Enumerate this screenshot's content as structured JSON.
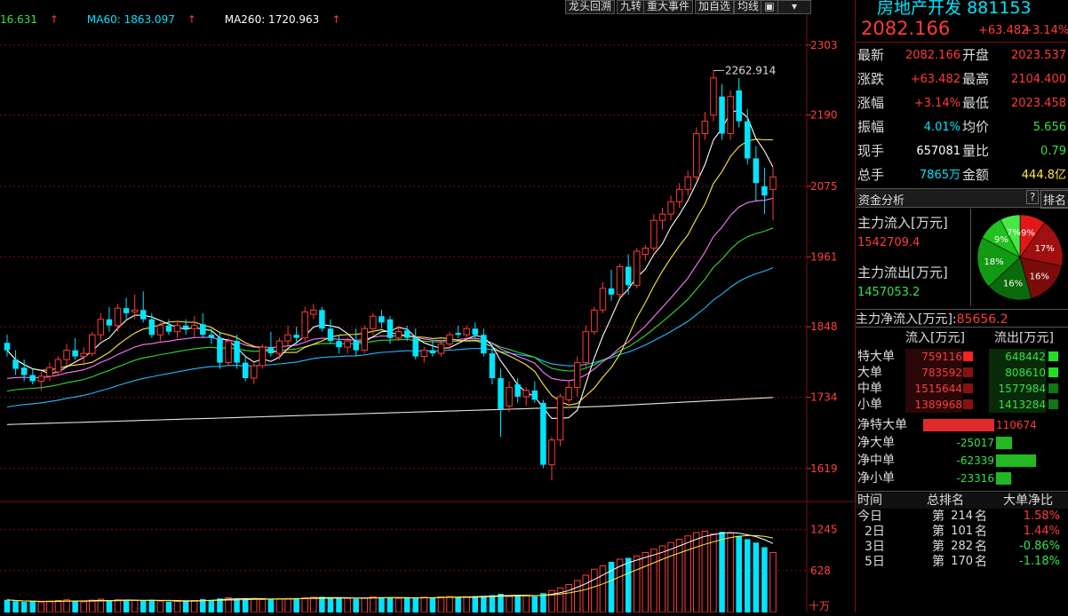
{
  "toolbar": {
    "buttons": [
      "龙头回溯",
      "九转",
      "重大事件",
      "加自选",
      "均线"
    ],
    "icons": [
      "restore-icon",
      "dropdown-icon"
    ]
  },
  "indicators": {
    "ma_partial": "16.631",
    "ma60": "MA60: 1863.097",
    "ma260": "MA260: 1720.963",
    "arrow": "↑"
  },
  "colors": {
    "up": "#ff3b3b",
    "down": "#00e5ff",
    "ma5": "#ffffff",
    "ma10": "#ffeb3b",
    "ma20": "#ff79ff",
    "ma30": "#33dd33",
    "ma60": "#22bbff",
    "ma260": "#e8e8d8",
    "grid": "#7a1010"
  },
  "price_axis": {
    "ticks": [
      "2303",
      "2190",
      "2075",
      "1961",
      "1848",
      "1734",
      "1619"
    ],
    "high_label": "2262.914"
  },
  "volume_axis": {
    "ticks": [
      "1245",
      "628"
    ],
    "unit": "十万"
  },
  "stock": {
    "name": "房地产开发",
    "code": "881153",
    "price": "2082.166",
    "change": "+63.482",
    "change_pct": "+3.14%"
  },
  "quote": [
    {
      "l1": "最新",
      "v1": "2082.166",
      "c1": "red",
      "l2": "开盘",
      "v2": "2023.537",
      "c2": "red"
    },
    {
      "l1": "涨跌",
      "v1": "+63.482",
      "c1": "red",
      "l2": "最高",
      "v2": "2104.400",
      "c2": "red"
    },
    {
      "l1": "涨幅",
      "v1": "+3.14%",
      "c1": "red",
      "l2": "最低",
      "v2": "2023.458",
      "c2": "red"
    },
    {
      "l1": "振幅",
      "v1": "4.01%",
      "c1": "cyan",
      "l2": "均价",
      "v2": "5.656",
      "c2": "green"
    },
    {
      "l1": "现手",
      "v1": "657081",
      "c1": "white",
      "l2": "量比",
      "v2": "0.79",
      "c2": "green"
    },
    {
      "l1": "总手",
      "v1": "7865万",
      "c1": "cyan",
      "l2": "金额",
      "v2": "444.8亿",
      "c2": "yellow"
    }
  ],
  "funds": {
    "header": "资金分析",
    "help": "?",
    "rank_btn": "排名",
    "inflow_label": "主力流入[万元]",
    "inflow_value": "1542709.4",
    "outflow_label": "主力流出[万元]",
    "outflow_value": "1457053.2",
    "net_label": "主力净流入[万元]:",
    "net_value": "85656.2",
    "pie": [
      {
        "pct": 9,
        "label": "9%",
        "color": "#e01818"
      },
      {
        "pct": 17,
        "label": "17%",
        "color": "#a01010"
      },
      {
        "pct": 16,
        "label": "16%",
        "color": "#7a0c0c"
      },
      {
        "pct": 16,
        "label": "16%",
        "color": "#0c6a0c"
      },
      {
        "pct": 18,
        "label": "18%",
        "color": "#139a13"
      },
      {
        "pct": 9,
        "label": "9%",
        "color": "#1fc21f"
      },
      {
        "pct": 7,
        "label": "7%",
        "color": "#45e845"
      }
    ]
  },
  "flow": {
    "col_in": "流入[万元]",
    "col_out": "流出[万元]",
    "rows": [
      {
        "name": "特大单",
        "in": "759116",
        "out": "648442"
      },
      {
        "name": "大单",
        "in": "783592",
        "out": "808610"
      },
      {
        "name": "中单",
        "in": "1515644",
        "out": "1577984"
      },
      {
        "name": "小单",
        "in": "1389968",
        "out": "1413284"
      }
    ],
    "net": [
      {
        "name": "净特大单",
        "value": "110674",
        "amount": 110674
      },
      {
        "name": "净大单",
        "value": "-25017",
        "amount": -25017
      },
      {
        "name": "净中单",
        "value": "-62339",
        "amount": -62339
      },
      {
        "name": "净小单",
        "value": "-23316",
        "amount": -23316
      }
    ]
  },
  "ranking": {
    "headers": [
      "时间",
      "总排名",
      "大单净比"
    ],
    "prefix": "第",
    "suffix": "名",
    "rows": [
      {
        "day": "今日",
        "rank": "214",
        "ratio": "1.58%",
        "up": true
      },
      {
        "day": "2日",
        "rank": "101",
        "ratio": "1.44%",
        "up": true
      },
      {
        "day": "3日",
        "rank": "282",
        "ratio": "-0.86%",
        "up": false
      },
      {
        "day": "5日",
        "rank": "170",
        "ratio": "-1.18%",
        "up": false
      }
    ]
  },
  "chart_data": {
    "type": "candlestick",
    "y_range": [
      1580,
      2330
    ],
    "volume_range": [
      0,
      1400
    ],
    "candles": [
      [
        1822,
        1835,
        1800,
        1810
      ],
      [
        1795,
        1810,
        1770,
        1780
      ],
      [
        1782,
        1795,
        1760,
        1770
      ],
      [
        1770,
        1780,
        1755,
        1760
      ],
      [
        1760,
        1775,
        1745,
        1768
      ],
      [
        1768,
        1790,
        1760,
        1782
      ],
      [
        1775,
        1800,
        1770,
        1795
      ],
      [
        1795,
        1820,
        1785,
        1810
      ],
      [
        1810,
        1830,
        1795,
        1800
      ],
      [
        1800,
        1815,
        1785,
        1805
      ],
      [
        1805,
        1840,
        1800,
        1835
      ],
      [
        1835,
        1870,
        1825,
        1860
      ],
      [
        1860,
        1880,
        1840,
        1850
      ],
      [
        1850,
        1885,
        1840,
        1878
      ],
      [
        1878,
        1895,
        1860,
        1870
      ],
      [
        1872,
        1900,
        1860,
        1875
      ],
      [
        1875,
        1905,
        1855,
        1860
      ],
      [
        1860,
        1870,
        1830,
        1835
      ],
      [
        1835,
        1855,
        1825,
        1850
      ],
      [
        1850,
        1860,
        1835,
        1840
      ],
      [
        1840,
        1858,
        1830,
        1850
      ],
      [
        1850,
        1860,
        1835,
        1845
      ],
      [
        1845,
        1865,
        1830,
        1850
      ],
      [
        1852,
        1870,
        1830,
        1835
      ],
      [
        1835,
        1845,
        1820,
        1830
      ],
      [
        1830,
        1840,
        1780,
        1790
      ],
      [
        1790,
        1830,
        1785,
        1825
      ],
      [
        1825,
        1835,
        1780,
        1790
      ],
      [
        1790,
        1800,
        1760,
        1765
      ],
      [
        1765,
        1790,
        1755,
        1785
      ],
      [
        1785,
        1820,
        1780,
        1815
      ],
      [
        1815,
        1840,
        1800,
        1805
      ],
      [
        1805,
        1830,
        1795,
        1825
      ],
      [
        1825,
        1850,
        1815,
        1835
      ],
      [
        1835,
        1848,
        1820,
        1830
      ],
      [
        1830,
        1880,
        1825,
        1872
      ],
      [
        1868,
        1885,
        1860,
        1875
      ],
      [
        1875,
        1880,
        1840,
        1845
      ],
      [
        1845,
        1860,
        1820,
        1825
      ],
      [
        1825,
        1835,
        1805,
        1815
      ],
      [
        1815,
        1830,
        1805,
        1825
      ],
      [
        1825,
        1845,
        1800,
        1810
      ],
      [
        1810,
        1850,
        1805,
        1845
      ],
      [
        1845,
        1870,
        1835,
        1865
      ],
      [
        1865,
        1875,
        1845,
        1855
      ],
      [
        1860,
        1865,
        1820,
        1830
      ],
      [
        1830,
        1850,
        1825,
        1840
      ],
      [
        1842,
        1850,
        1825,
        1830
      ],
      [
        1830,
        1845,
        1795,
        1800
      ],
      [
        1800,
        1815,
        1790,
        1810
      ],
      [
        1810,
        1825,
        1800,
        1805
      ],
      [
        1805,
        1825,
        1800,
        1820
      ],
      [
        1820,
        1840,
        1810,
        1835
      ],
      [
        1838,
        1850,
        1830,
        1835
      ],
      [
        1835,
        1850,
        1825,
        1845
      ],
      [
        1845,
        1855,
        1830,
        1835
      ],
      [
        1835,
        1845,
        1800,
        1805
      ],
      [
        1805,
        1820,
        1755,
        1765
      ],
      [
        1765,
        1780,
        1670,
        1715
      ],
      [
        1720,
        1760,
        1710,
        1750
      ],
      [
        1755,
        1765,
        1725,
        1735
      ],
      [
        1735,
        1750,
        1720,
        1745
      ],
      [
        1745,
        1760,
        1725,
        1730
      ],
      [
        1725,
        1730,
        1620,
        1625
      ],
      [
        1625,
        1670,
        1600,
        1665
      ],
      [
        1665,
        1740,
        1655,
        1735
      ],
      [
        1730,
        1760,
        1725,
        1750
      ],
      [
        1750,
        1800,
        1735,
        1790
      ],
      [
        1790,
        1850,
        1780,
        1840
      ],
      [
        1840,
        1880,
        1835,
        1875
      ],
      [
        1875,
        1920,
        1870,
        1910
      ],
      [
        1910,
        1940,
        1890,
        1900
      ],
      [
        1900,
        1950,
        1895,
        1945
      ],
      [
        1945,
        1965,
        1900,
        1915
      ],
      [
        1915,
        1975,
        1910,
        1970
      ],
      [
        1965,
        1980,
        1955,
        1975
      ],
      [
        1975,
        2030,
        1970,
        2020
      ],
      [
        2020,
        2040,
        2005,
        2030
      ],
      [
        2030,
        2060,
        2020,
        2050
      ],
      [
        2050,
        2080,
        2040,
        2070
      ],
      [
        2070,
        2100,
        2060,
        2090
      ],
      [
        2090,
        2170,
        2085,
        2160
      ],
      [
        2160,
        2195,
        2150,
        2180
      ],
      [
        2190,
        2262,
        2180,
        2250
      ],
      [
        2220,
        2240,
        2150,
        2160
      ],
      [
        2160,
        2230,
        2150,
        2220
      ],
      [
        2230,
        2250,
        2170,
        2180
      ],
      [
        2180,
        2200,
        2110,
        2120
      ],
      [
        2120,
        2140,
        2050,
        2080
      ],
      [
        2075,
        2105,
        2030,
        2060
      ],
      [
        2070,
        2105,
        2020,
        2090
      ]
    ],
    "volume": [
      190,
      170,
      160,
      165,
      150,
      170,
      180,
      190,
      170,
      160,
      185,
      200,
      180,
      190,
      175,
      180,
      185,
      190,
      170,
      160,
      165,
      175,
      180,
      200,
      190,
      210,
      220,
      205,
      210,
      200,
      195,
      200,
      205,
      210,
      215,
      220,
      230,
      235,
      220,
      215,
      210,
      205,
      220,
      235,
      230,
      225,
      210,
      215,
      220,
      230,
      225,
      235,
      240,
      230,
      235,
      245,
      250,
      260,
      280,
      240,
      260,
      250,
      240,
      290,
      330,
      370,
      420,
      480,
      560,
      650,
      700,
      760,
      800,
      820,
      850,
      900,
      950,
      1000,
      1050,
      1100,
      1150,
      1200,
      1220,
      1180,
      1210,
      1190,
      1150,
      1100,
      1050,
      980,
      900
    ]
  }
}
